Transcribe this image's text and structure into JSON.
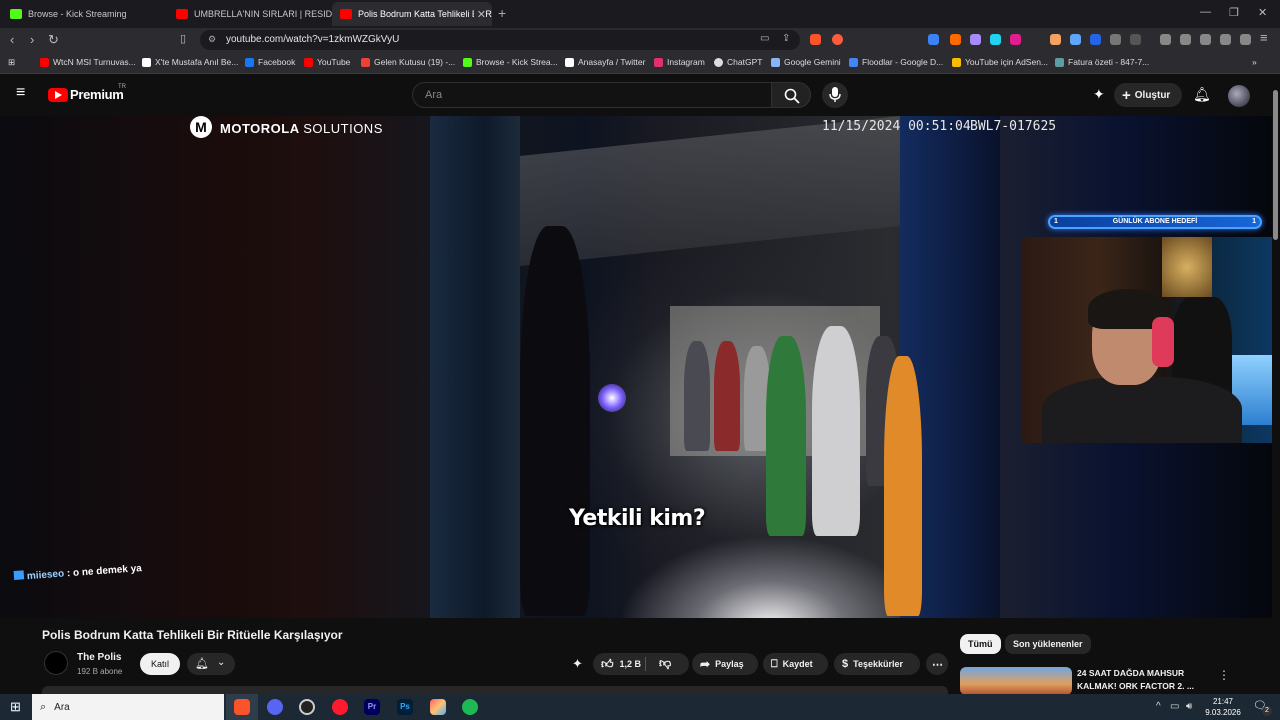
{
  "browser": {
    "tabs": [
      {
        "title": "Browse - Kick Streaming",
        "favicon_color": "#53fc18",
        "active": false
      },
      {
        "title": "UMBRELLA'NIN SIRLARI | RESIDENT",
        "favicon_color": "#ff0000",
        "active": false
      },
      {
        "title": "Polis Bodrum Katta Tehlikeli Bir R",
        "favicon_color": "#ff0000",
        "active": true
      }
    ],
    "new_tab_icon": "plus",
    "url": "youtube.com/watch?v=1zkmWZGkVyU",
    "bookmarks": [
      {
        "label": "WtcN MSI Turnuvas...",
        "icon_color": "#ff0000"
      },
      {
        "label": "X'te Mustafa Anıl Be...",
        "icon_color": "#ffffff"
      },
      {
        "label": "Facebook",
        "icon_color": "#1877f2"
      },
      {
        "label": "YouTube",
        "icon_color": "#ff0000"
      },
      {
        "label": "Gelen Kutusu (19) -...",
        "icon_color": "#ea4335"
      },
      {
        "label": "Browse - Kick Strea...",
        "icon_color": "#53fc18"
      },
      {
        "label": "Anasayfa / Twitter",
        "icon_color": "#ffffff"
      },
      {
        "label": "Instagram",
        "icon_color": "#e1306c"
      },
      {
        "label": "ChatGPT",
        "icon_color": "#dddddd"
      },
      {
        "label": "Google Gemini",
        "icon_color": "#8ab4f8"
      },
      {
        "label": "Floodlar - Google D...",
        "icon_color": "#4285f4"
      },
      {
        "label": "YouTube için AdSen...",
        "icon_color": "#fbbc04"
      },
      {
        "label": "Fatura özeti - 847-7...",
        "icon_color": "#5f9ea0"
      }
    ]
  },
  "youtube": {
    "logo_text": "Premium",
    "logo_region": "TR",
    "search_placeholder": "Ara",
    "create_label": "Oluştur"
  },
  "video": {
    "watermark_brand": "MOTOROLA",
    "watermark_brand_suffix": "SOLUTIONS",
    "timestamp": "11/15/2024 00:51:04",
    "device_id": "BWL7-017625",
    "subtitle": "Yetkili kim?",
    "chat_user": "miieseo",
    "chat_message": ": o ne demek ya",
    "goal_label": "GÜNLÜK ABONE HEDEFİ",
    "goal_current": "1",
    "goal_target": "1"
  },
  "watch": {
    "title": "Polis Bodrum Katta Tehlikeli Bir Ritüelle Karşılaşıyor",
    "channel_name": "The Polis",
    "channel_subs": "192 B abone",
    "join_label": "Katıl",
    "likes": "1,2 B",
    "share_label": "Paylaş",
    "save_label": "Kaydet",
    "thanks_label": "Teşekkürler",
    "chips": [
      "Tümü",
      "Son yüklenenler"
    ],
    "recommended": [
      {
        "title": "24 SAAT DAĞDA MAHSUR KALMAK! ORK FACTOR 2. ..."
      }
    ]
  },
  "taskbar": {
    "search_placeholder": "Ara",
    "time": "21:47",
    "date": "9.03.2026",
    "notification_count": "2"
  }
}
